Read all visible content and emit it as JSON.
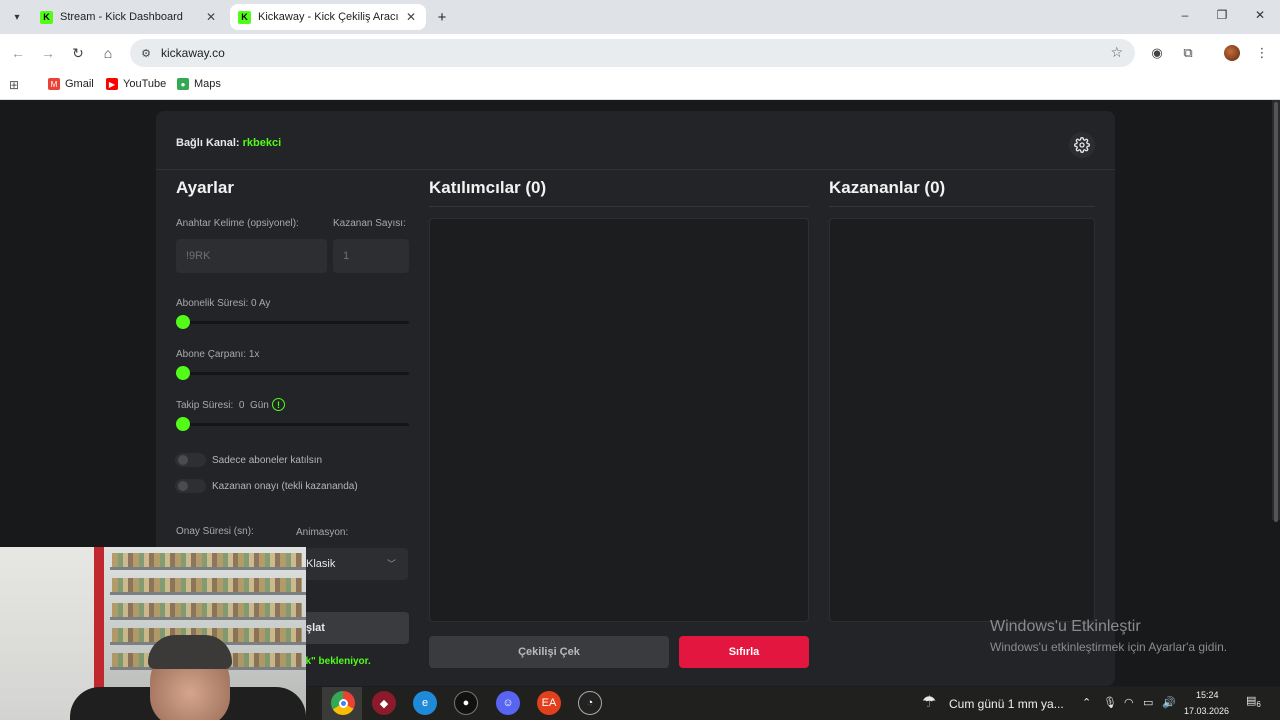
{
  "browser": {
    "tabs": [
      {
        "label": "Stream - Kick Dashboard",
        "favicon": "K",
        "active": false
      },
      {
        "label": "Kickaway - Kick Çekiliş Aracı",
        "favicon": "K",
        "active": true
      }
    ],
    "url": "kickaway.co",
    "bookmarks": [
      {
        "label": "Gmail",
        "icon": "gmail-icon",
        "color": "#ea4335"
      },
      {
        "label": "YouTube",
        "icon": "youtube-icon",
        "color": "#ff0000"
      },
      {
        "label": "Maps",
        "icon": "maps-icon",
        "color": "#34a853"
      }
    ]
  },
  "header": {
    "channel_prefix": "Bağlı Kanal:",
    "channel_name": "rkbekci"
  },
  "settings": {
    "title": "Ayarlar",
    "keyword_label": "Anahtar Kelime (opsiyonel):",
    "keyword_value": "!9RK",
    "winner_count_label": "Kazanan Sayısı:",
    "winner_count_value": "1",
    "sub_duration_label": "Abonelik Süresi: 0 Ay",
    "sub_duration_value": 0,
    "sub_multiplier_label": "Abone Çarpanı: 1x",
    "sub_multiplier_value": 1,
    "follow_label": "Takip Süresi:",
    "follow_value_text": "0",
    "follow_unit": "Gün",
    "follow_value": 0,
    "toggle_subs_only": "Sadece aboneler katılsın",
    "toggle_subs_only_on": false,
    "toggle_winner_confirm": "Kazanan onayı (tekli kazananda)",
    "toggle_winner_confirm_on": false,
    "confirm_time_label": "Onay Süresi (sn):",
    "animation_label": "Animasyon:",
    "animation_value": "Klasik",
    "start_label": "şlat",
    "waiting_text": "9rk\" bekleniyor."
  },
  "participants": {
    "title": "Katılımcılar (0)"
  },
  "winners": {
    "title": "Kazananlar (0)"
  },
  "actions": {
    "draw": "Çekilişi Çek",
    "reset": "Sıfırla"
  },
  "watermark": {
    "title": "Windows'u Etkinleştir",
    "subtitle": "Windows'u etkinleştirmek için Ayarlar'a gidin."
  },
  "taskbar": {
    "weather": "Cum günü 1 mm ya...",
    "time": "15:24",
    "date": "17.03.2026",
    "notifications": "6"
  },
  "colors": {
    "accent": "#53fc18",
    "danger": "#e3163f",
    "card": "#232427"
  }
}
